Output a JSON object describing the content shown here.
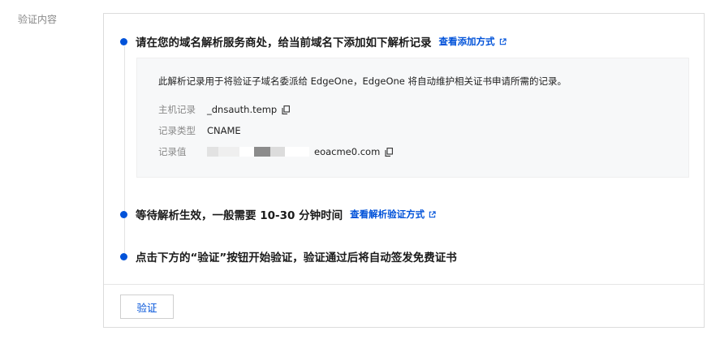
{
  "field_label": "验证内容",
  "steps": [
    {
      "title": "请在您的域名解析服务商处，给当前域名下添加如下解析记录",
      "link_label": "查看添加方式"
    },
    {
      "title": "等待解析生效，一般需要 10-30 分钟时间",
      "link_label": "查看解析验证方式"
    },
    {
      "title": "点击下方的“验证”按钮开始验证，验证通过后将自动签发免费证书"
    }
  ],
  "record": {
    "description": "此解析记录用于将验证子域名委派给 EdgeOne，EdgeOne 将自动维护相关证书申请所需的记录。",
    "host_label": "主机记录",
    "host_value": "_dnsauth.temp",
    "type_label": "记录类型",
    "type_value": "CNAME",
    "value_label": "记录值",
    "value_suffix": "eoacme0.com"
  },
  "verify_button_label": "验证",
  "colors": {
    "accent": "#0052d9",
    "panel_border": "#dcdcdc",
    "record_bg": "#f7f8f9"
  }
}
